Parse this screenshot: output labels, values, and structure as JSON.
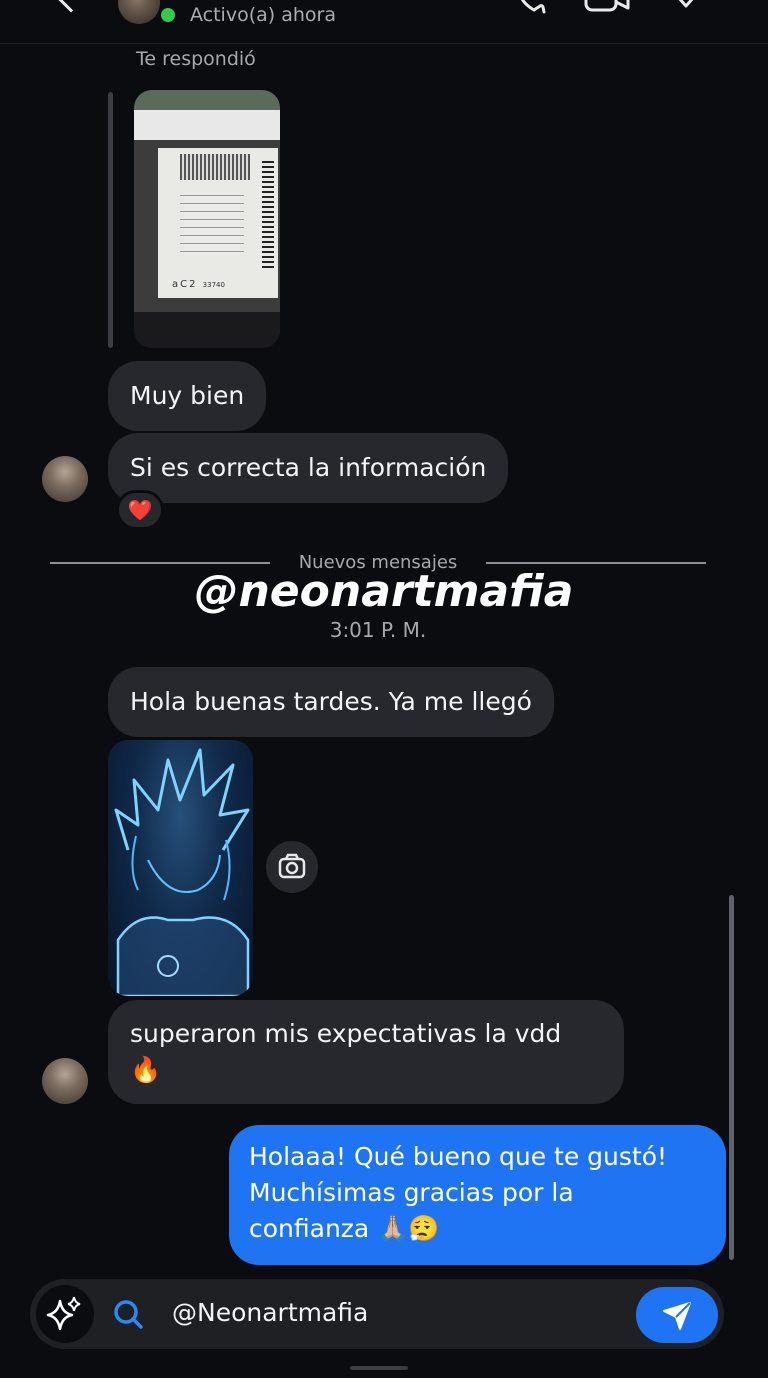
{
  "header": {
    "status": "Activo(a) ahora",
    "back_icon": "chevron-left-icon",
    "call_icon": "phone-icon",
    "video_icon": "video-camera-icon",
    "info_icon": "heart-icon"
  },
  "reply": {
    "label": "Te respondió",
    "image_code": "aC2",
    "image_number": "33740"
  },
  "messages": {
    "incoming_1": "Muy bien",
    "incoming_2": "Si es correcta la información",
    "reaction": "❤️",
    "divider": "Nuevos mensajes",
    "watermark": "@neonartmafia",
    "time": "3:01 P. M.",
    "incoming_3": "Hola buenas tardes. Ya me llegó",
    "incoming_4_line1": "superaron mis expectativas la vdd",
    "incoming_4_line2": "🔥",
    "outgoing_line1": "Holaaa! Qué bueno que te gustó!",
    "outgoing_line2": "Muchísimas gracias por la",
    "outgoing_line3": "confianza 🙏🏼😮‍💨"
  },
  "composer": {
    "value": "@Neonartmafia",
    "sparkle_icon": "sparkle-icon",
    "search_icon": "search-icon",
    "send_icon": "send-icon"
  },
  "colors": {
    "background": "#0b0c0f",
    "incoming_bubble": "#26282d",
    "outgoing_bubble": "#1f74f3",
    "online": "#2ecb4f"
  }
}
